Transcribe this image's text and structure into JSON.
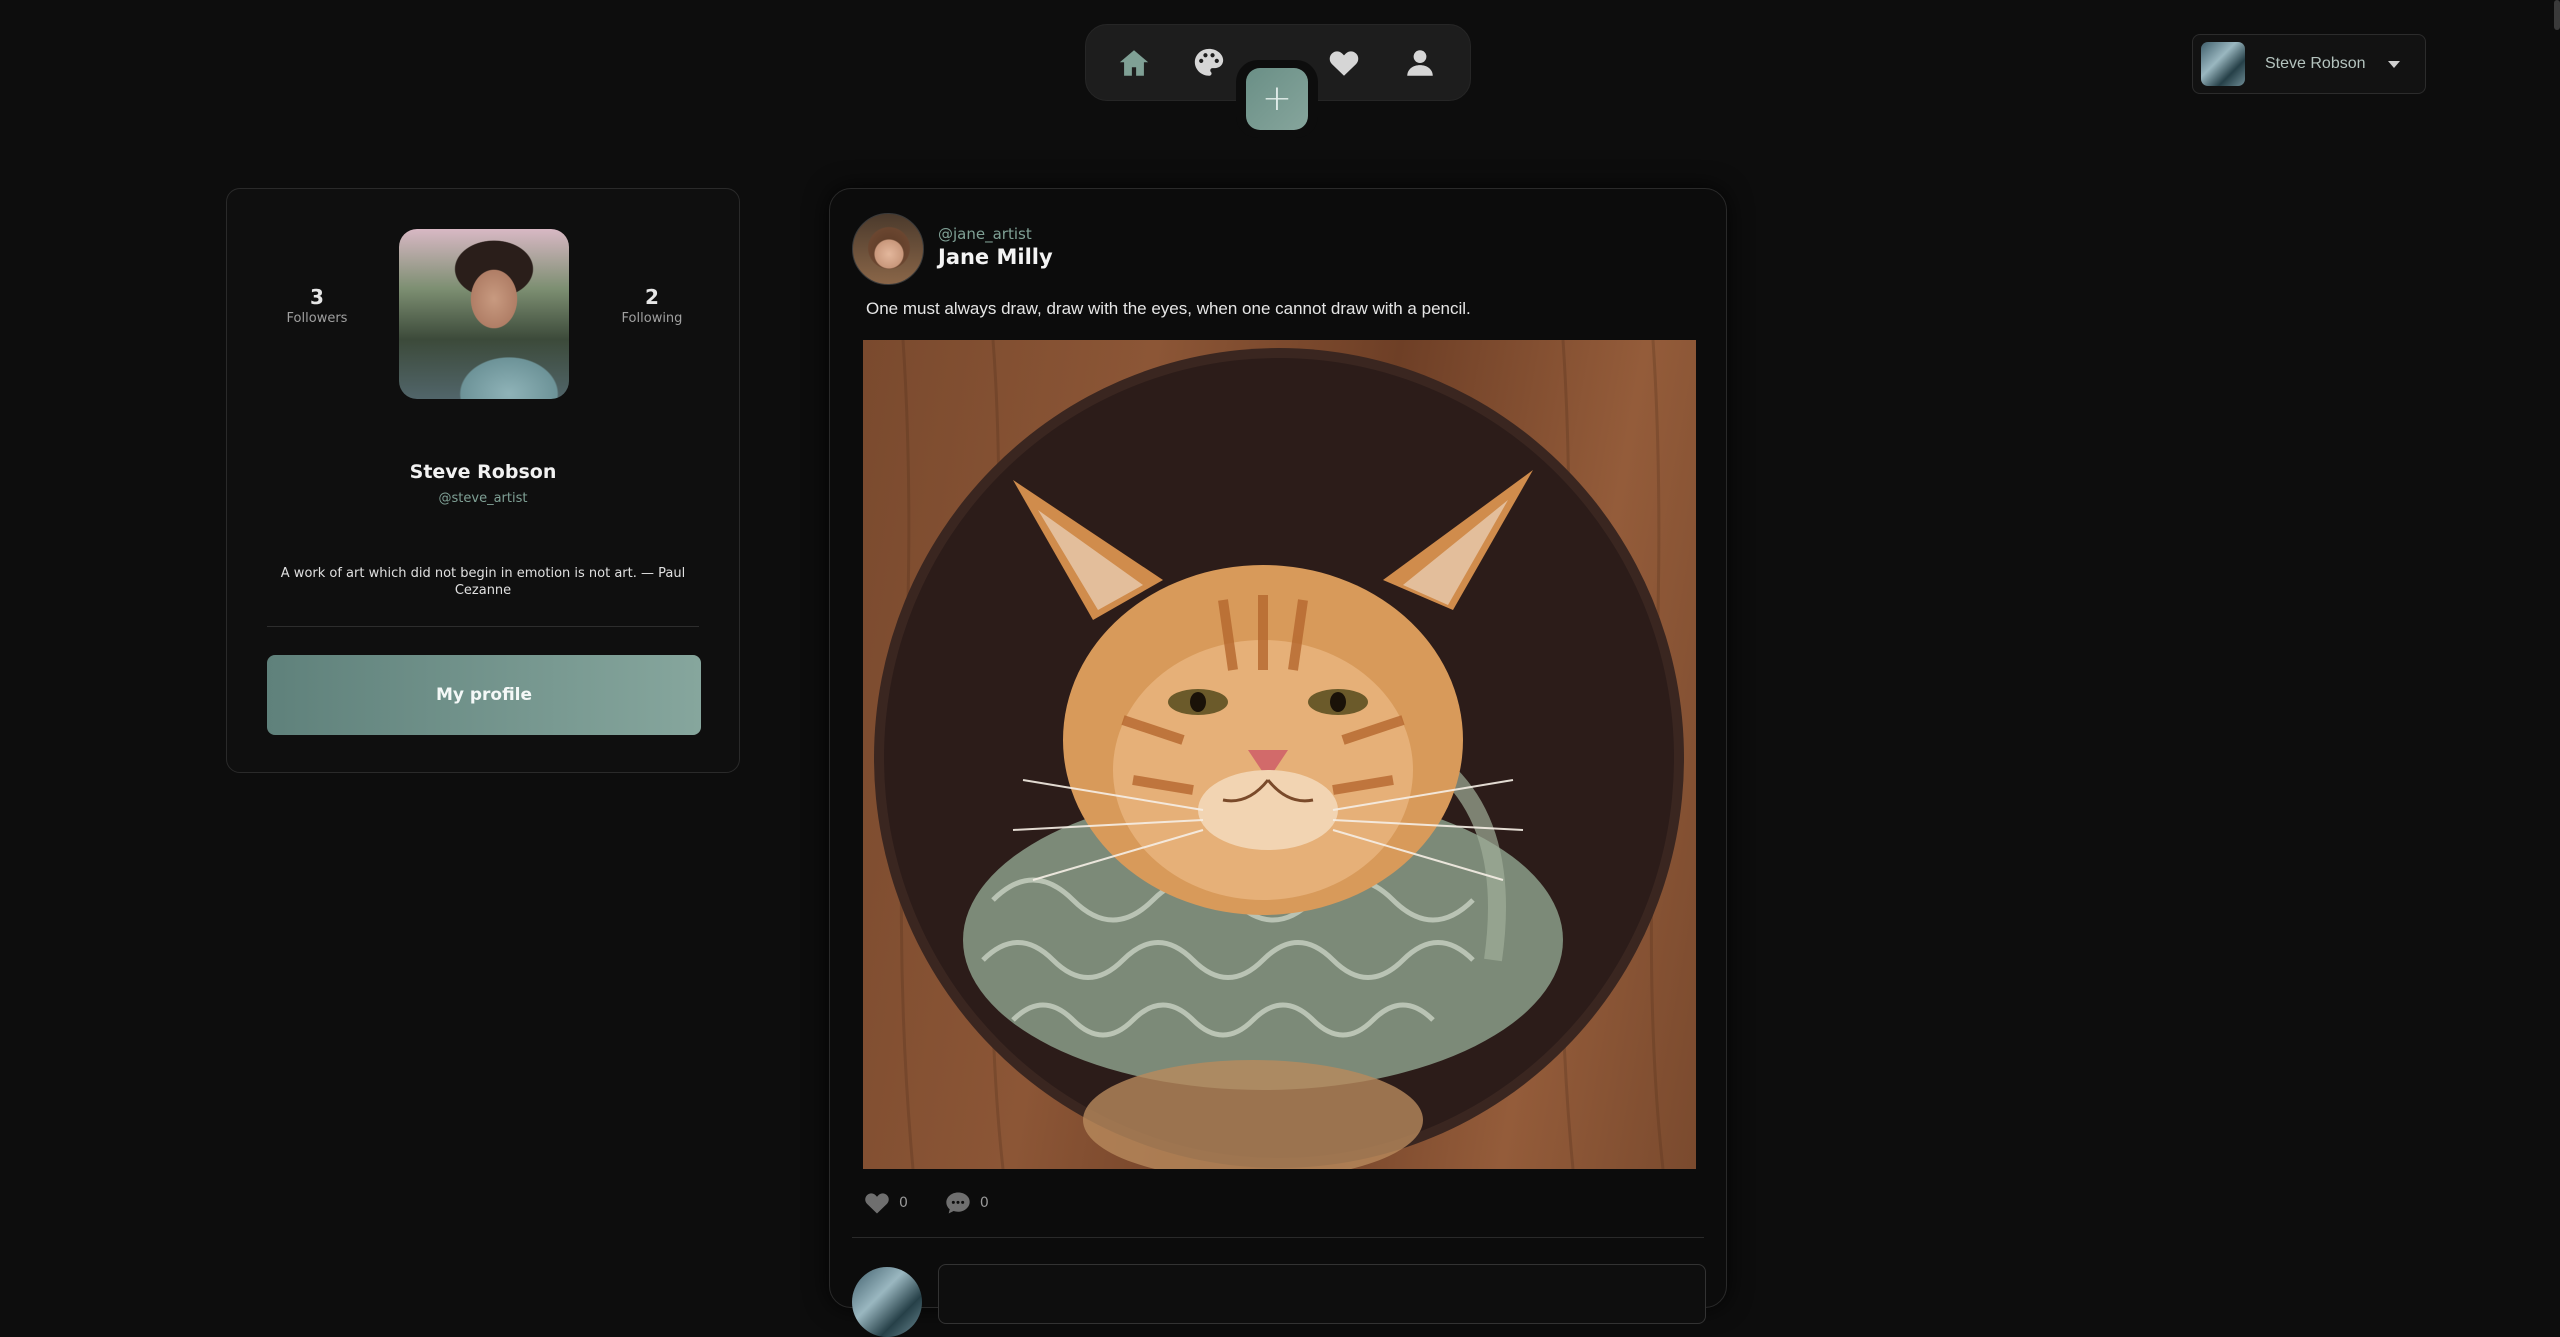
{
  "nav": {
    "icons": [
      "home-icon",
      "palette-icon",
      "heart-icon",
      "user-icon"
    ],
    "active_color": "#7fa095",
    "add_label": "+"
  },
  "user_menu": {
    "name": "Steve Robson"
  },
  "profile": {
    "followers_count": "3",
    "followers_label": "Followers",
    "following_count": "2",
    "following_label": "Following",
    "name": "Steve Robson",
    "handle": "@steve_artist",
    "bio": "A work of art which did not begin in emotion is not art. — Paul Cezanne",
    "button_label": "My profile"
  },
  "post": {
    "handle": "@jane_artist",
    "author": "Jane Milly",
    "text": "One must always draw, draw with the eyes, when one cannot draw with a pencil.",
    "image_alt": "Painting of a ginger cat wearing a ruffled collar",
    "likes": "0",
    "comments": "0"
  },
  "colors": {
    "accent": "#7fa095",
    "background": "#0d0d0d",
    "button_gradient_start": "#5f817b",
    "button_gradient_end": "#86a69d"
  }
}
